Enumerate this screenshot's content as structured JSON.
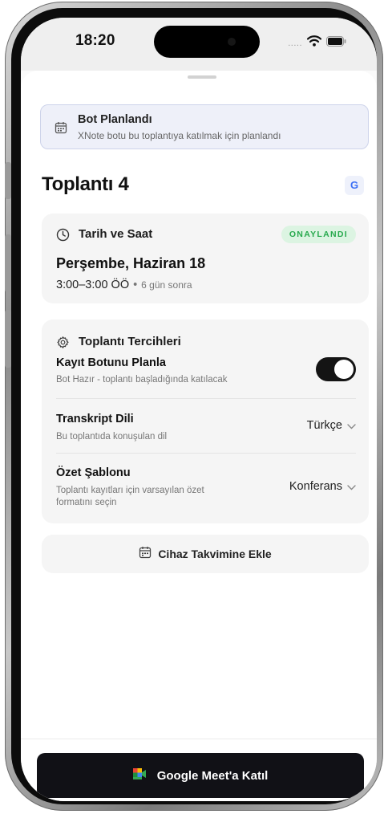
{
  "status_bar": {
    "time": "18:20",
    "signal_dots": "....."
  },
  "banner": {
    "title": "Bot Planlandı",
    "subtitle": "XNote botu bu toplantıya katılmak için planlandı"
  },
  "meeting": {
    "title": "Toplantı 4",
    "calendar_badge": "G"
  },
  "datetime_card": {
    "heading": "Tarih ve Saat",
    "status_badge": "ONAYLANDI",
    "date": "Perşembe, Haziran 18",
    "time_range": "3:00–3:00 ÖÖ",
    "separator": "•",
    "relative": "6 gün sonra"
  },
  "preferences": {
    "heading": "Toplantı Tercihleri",
    "record_bot": {
      "title": "Kayıt Botunu Planla",
      "subtitle": "Bot Hazır - toplantı başladığında katılacak",
      "enabled": true
    },
    "transcript_language": {
      "title": "Transkript Dili",
      "subtitle": "Bu toplantıda konuşulan dil",
      "value": "Türkçe"
    },
    "summary_template": {
      "title": "Özet Şablonu",
      "subtitle_line1": "Toplantı kayıtları için varsayılan özet",
      "subtitle_line2": "formatını seçin",
      "value": "Konferans"
    }
  },
  "add_to_calendar": {
    "label": "Cihaz Takvimine Ekle"
  },
  "join_button": {
    "label": "Google Meet'a Katıl"
  },
  "colors": {
    "accent_dark": "#111116",
    "confirmed_green": "#27a94d",
    "banner_bg": "#eef0f9",
    "google_blue": "#3b6ff5"
  },
  "icons": {
    "banner": "calendar-icon",
    "datetime": "clock-icon",
    "preferences": "gear-icon",
    "add_calendar": "calendar-icon",
    "join": "google-meet-icon",
    "dropdown": "chevron-down-icon"
  }
}
